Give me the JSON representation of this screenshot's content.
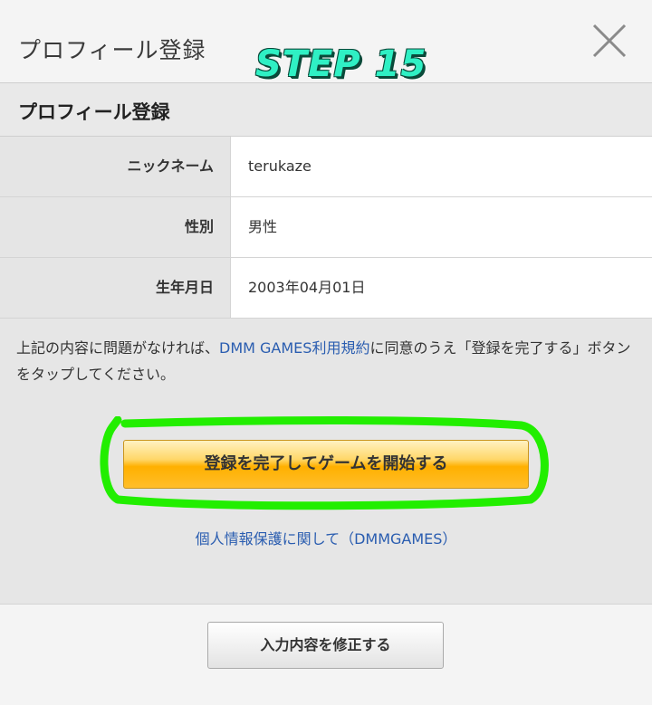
{
  "header": {
    "title": "プロフィール登録",
    "step_label": "STEP 15",
    "close_icon": "close-icon"
  },
  "section": {
    "title": "プロフィール登録"
  },
  "profile_rows": [
    {
      "label": "ニックネーム",
      "value": "terukaze"
    },
    {
      "label": "性別",
      "value": "男性"
    },
    {
      "label": "生年月日",
      "value": "2003年04月01日"
    }
  ],
  "notice": {
    "text_before": "上記の内容に問題がなければ、",
    "terms_link": "DMM GAMES利用規約",
    "text_after": "に同意のうえ「登録を完了する」ボタンをタップしてください。"
  },
  "actions": {
    "complete_label": "登録を完了してゲームを開始する",
    "privacy_link": "個人情報保護に関して（DMMGAMES）",
    "edit_label": "入力内容を修正する"
  },
  "colors": {
    "link": "#2a5db0",
    "primary_button": "#ffb000",
    "highlight": "#22ee00",
    "step_label": "#2ff0c4"
  }
}
